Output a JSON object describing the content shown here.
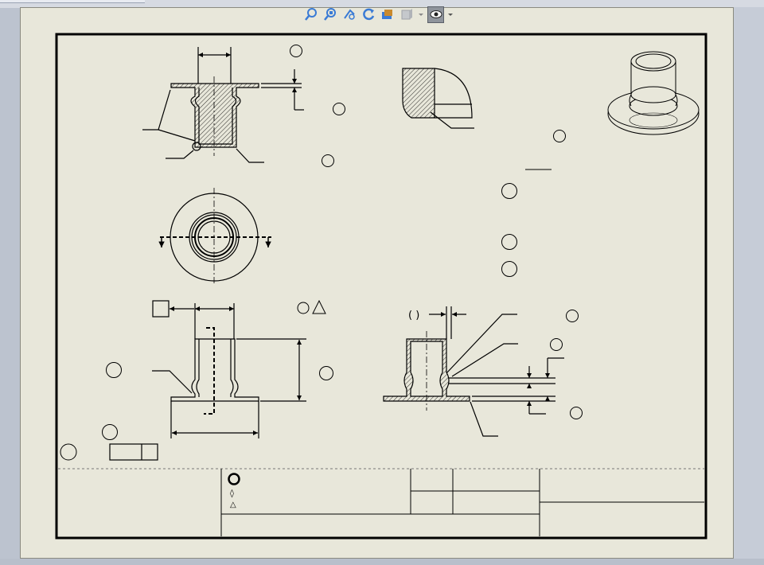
{
  "toolbar": {
    "items": [
      {
        "icon": "zoom-to-fit-icon"
      },
      {
        "icon": "zoom-to-area-icon"
      },
      {
        "icon": "previous-view-icon"
      },
      {
        "icon": "rotate-view-icon"
      },
      {
        "icon": "pan-view-icon"
      },
      {
        "icon": "view-orientation-icon"
      },
      {
        "icon": "dropdown-arrow-icon"
      },
      {
        "icon": "hide-show-items-icon",
        "selected": true
      },
      {
        "icon": "dropdown-arrow-icon"
      }
    ]
  },
  "drawing": {
    "dimension_text": {
      "parentheses": "(  )"
    },
    "datum_label": "",
    "title_block": {
      "symbols": [
        "○",
        "◊",
        "△"
      ]
    }
  },
  "colors": {
    "sheet": "#e8e7da",
    "line": "#000000",
    "toolbar_icon": "#3a7bd5",
    "workspace": "#bcc3cf"
  }
}
